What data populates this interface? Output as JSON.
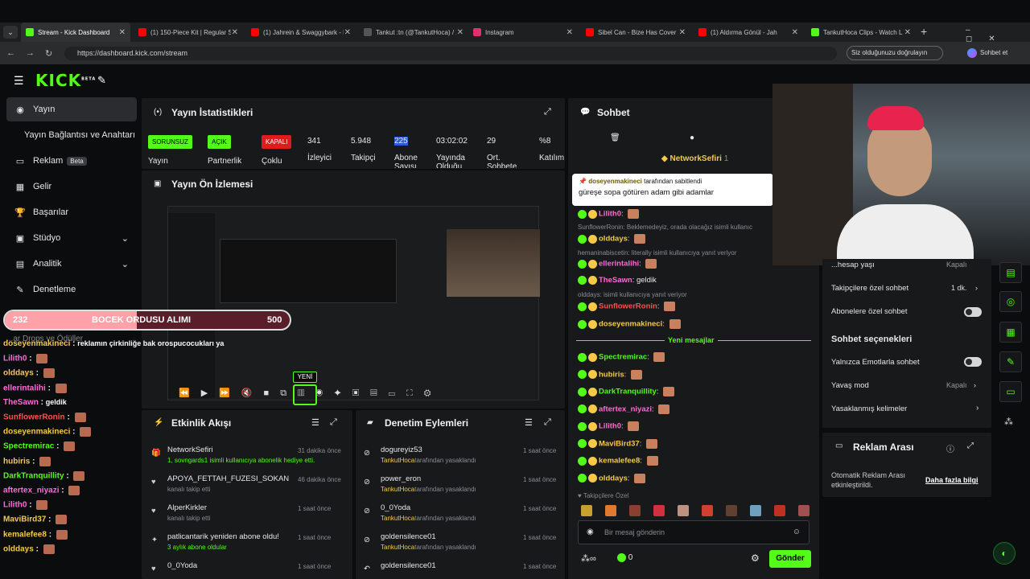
{
  "browser": {
    "tabs": [
      {
        "label": "Stream - Kick Dashboard",
        "color": "#53fc18",
        "active": true
      },
      {
        "label": "(1) 150-Piece Kit | Regular Sh",
        "color": "#ff0000",
        "active": false
      },
      {
        "label": "(1) Jahrein & Swaggybark - B",
        "color": "#ff0000",
        "active": false
      },
      {
        "label": "Tankut :tn (@TankutHoca) / X",
        "color": "#555555",
        "active": false
      },
      {
        "label": "Instagram",
        "color": "#e1306c",
        "active": false
      },
      {
        "label": "Sibel Can - Bize Has Cover |",
        "color": "#ff0000",
        "active": false
      },
      {
        "label": "(1) Aldırma Gönül - Jah",
        "color": "#ff0000",
        "active": false
      },
      {
        "label": "TankutHoca Clips - Watch L",
        "color": "#53fc18",
        "active": false
      }
    ],
    "url": "https://dashboard.kick.com/stream",
    "verify_label": "Siz olduğunuzu doğrulayın",
    "sync_label": "Sohbet et"
  },
  "logo": {
    "text": "KICK",
    "beta": "BETA"
  },
  "sidebar": {
    "items": [
      {
        "label": "Yayın",
        "icon": "broadcast-icon"
      },
      {
        "label": "Yayın Bağlantısı ve Anahtarı",
        "icon": ""
      },
      {
        "label": "Reklam",
        "icon": "ad-icon",
        "badge": "Beta"
      },
      {
        "label": "Gelir",
        "icon": "grid-icon"
      },
      {
        "label": "Başarılar",
        "icon": "trophy-icon"
      },
      {
        "label": "Stüdyo",
        "icon": "studio-icon"
      },
      {
        "label": "Analitik",
        "icon": "chart-icon"
      },
      {
        "label": "Denetleme",
        "icon": "wrench-icon"
      }
    ]
  },
  "stats": {
    "title": "Yayın İstatistikleri",
    "status": {
      "problem": "SORUNSUZ",
      "open": "AÇIK",
      "closed": "KAPALI"
    },
    "labels": {
      "stream": "Yayın",
      "partner": "Partnerlik",
      "multi": "Çoklu"
    },
    "viewers": {
      "value": "341",
      "label": "İzleyici"
    },
    "followers": {
      "value": "5.948",
      "label": "Takipçi"
    },
    "subs": {
      "value": "225",
      "label": "Abone Sayısı"
    },
    "uptime": {
      "value": "03:02:02",
      "label": "Yayında Olduğu"
    },
    "avg": {
      "value": "29",
      "label": "Ort. Sohbete"
    },
    "participation": {
      "value": "%8",
      "label": "Katılım"
    }
  },
  "preview": {
    "title": "Yayın Ön İzlemesi",
    "new_label": "YENİ"
  },
  "goal": {
    "current": "232",
    "title": "BOCEK ORDUSU ALIMI",
    "target": "500",
    "progress": 0.464
  },
  "overlay_chat": [
    {
      "user": "doseyenmakineci",
      "color": "#f6c94a",
      "text": "reklamın çirkinliğe bak orospucocukları ya"
    },
    {
      "user": "Lilith0",
      "color": "#ff6bd6",
      "text": ""
    },
    {
      "user": "olddays",
      "color": "#f6c94a",
      "text": ""
    },
    {
      "user": "ellerintalihi",
      "color": "#ff6bd6",
      "text": ""
    },
    {
      "user": "TheSawn",
      "color": "#ff6bd6",
      "text": "geldik"
    },
    {
      "user": "SunflowerRonin",
      "color": "#ff4f4f",
      "text": ""
    },
    {
      "user": "doseyenmakineci",
      "color": "#f6c94a",
      "text": ""
    },
    {
      "user": "Spectremirac",
      "color": "#53fc18",
      "text": ""
    },
    {
      "user": "hubiris",
      "color": "#f6c94a",
      "text": ""
    },
    {
      "user": "DarkTranquillity",
      "color": "#53fc18",
      "text": ""
    },
    {
      "user": "aftertex_niyazi",
      "color": "#ff6bd6",
      "text": ""
    },
    {
      "user": "Lilith0",
      "color": "#ff6bd6",
      "text": ""
    },
    {
      "user": "MaviBird37",
      "color": "#f6c94a",
      "text": ""
    },
    {
      "user": "kemalefee8",
      "color": "#f6c94a",
      "text": ""
    },
    {
      "user": "olddays",
      "color": "#f6c94a",
      "text": ""
    }
  ],
  "overlay_hidden_label": "...ar Drops ve Ödüller",
  "activity": {
    "title": "Etkinlik Akışı",
    "items": [
      {
        "name": "NetworkSefiri",
        "detail": "1, sovngards1 isimli kullanıcıya abonelik hediye etti.",
        "time": "31 dakika önce"
      },
      {
        "name": "APOYA_FETTAH_FUZESI_SOKAN",
        "detail": "kanalı takip etti",
        "time": "46 dakika önce"
      },
      {
        "name": "AlperKirkler",
        "detail": "kanalı takip etti",
        "time": "1 saat önce"
      },
      {
        "name": "patlicantarik yeniden abone oldu!",
        "detail": "3 aylık abone oldular",
        "time": "1 saat önce"
      },
      {
        "name": "0_0Yoda",
        "detail": "",
        "time": "1 saat önce"
      }
    ]
  },
  "moderation": {
    "title": "Denetim Eylemleri",
    "items": [
      {
        "name": "dogureyiz53",
        "by": "TankutHoca",
        "detail": "tarafından yasaklandı",
        "time": "1 saat önce"
      },
      {
        "name": "power_eron",
        "by": "TankutHoca",
        "detail": "tarafından yasaklandı",
        "time": "1 saat önce"
      },
      {
        "name": "0_0Yoda",
        "by": "TankutHoca",
        "detail": "tarafından yasaklandı",
        "time": "1 saat önce"
      },
      {
        "name": "goldensilence01",
        "by": "TankutHoca",
        "detail": "tarafından yasaklandı",
        "time": "1 saat önce"
      },
      {
        "name": "goldensilence01",
        "by": "",
        "detail": "",
        "time": "1 saat önce"
      }
    ]
  },
  "chat": {
    "title": "Sohbet",
    "top_gifter": "NetworkSefiri",
    "top_gifter_count": "1",
    "pinned_by": "doseyenmakineci",
    "pinned_suffix": "tarafından sabitlendi",
    "pinned_text": "güreşe sopa götüren adam gibi adamlar",
    "lines_top": [
      {
        "user": "Lilith0",
        "color": "#ff6bd6",
        "text": ""
      },
      {
        "user": "",
        "color": "#8a8d90",
        "text": "SunflowerRonin: Beklemedeyiz, orada olacağız isimli kullanıc"
      },
      {
        "user": "olddays",
        "color": "#f6c94a",
        "text": ""
      },
      {
        "user": "",
        "color": "#8a8d90",
        "text": "hemaninabiscetin: literally isimli kullanıcıya yanıt veriyor"
      },
      {
        "user": "ellerintalihi",
        "color": "#ff6bd6",
        "text": ""
      },
      {
        "user": "TheSawn",
        "color": "#ff6bd6",
        "text": "geldik"
      },
      {
        "user": "",
        "color": "#8a8d90",
        "text": "olddays: isimli kullanıcıya yanıt veriyor"
      },
      {
        "user": "SunflowerRonin",
        "color": "#ff4f4f",
        "text": ""
      },
      {
        "user": "doseyenmakineci",
        "color": "#f6c94a",
        "text": ""
      }
    ],
    "new_messages": "Yeni mesajlar",
    "lines_bottom": [
      {
        "user": "Spectremirac",
        "color": "#53fc18",
        "text": ""
      },
      {
        "user": "hubiris",
        "color": "#f6c94a",
        "text": ""
      },
      {
        "user": "DarkTranquillity",
        "color": "#53fc18",
        "text": ""
      },
      {
        "user": "aftertex_niyazi",
        "color": "#ff6bd6",
        "text": ""
      },
      {
        "user": "Lilith0",
        "color": "#ff6bd6",
        "text": ""
      },
      {
        "user": "MaviBird37",
        "color": "#f6c94a",
        "text": ""
      },
      {
        "user": "kemalefee8",
        "color": "#f6c94a",
        "text": ""
      },
      {
        "user": "olddays",
        "color": "#f6c94a",
        "text": ""
      }
    ],
    "followers_only": "Takipçilere Özel",
    "input_placeholder": "Bir mesaj gönderin",
    "points": "0",
    "send": "Gönder"
  },
  "chat_settings": {
    "partial_label": "...hesap yaşı",
    "partial_value": "Kapalı",
    "followers_only": {
      "label": "Takipçilere özel sohbet",
      "value": "1 dk."
    },
    "subs_only": "Abonelere özel sohbet",
    "options_title": "Sohbet seçenekleri",
    "emotes_only": "Yalnızca Emotlarla sohbet",
    "slow_mode": {
      "label": "Yavaş mod",
      "value": "Kapalı"
    },
    "banned_words": "Yasaklanmış kelimeler"
  },
  "ad_break": {
    "title": "Reklam Arası",
    "text": "Otomatik Reklam Arası etkinleştirildi.",
    "link": "Daha fazla bilgi"
  }
}
